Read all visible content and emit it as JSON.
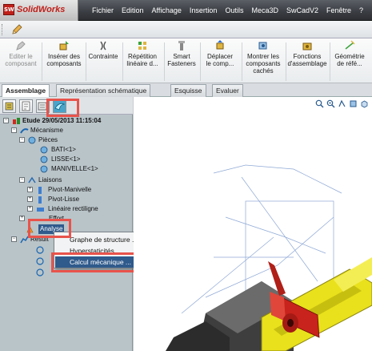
{
  "app": {
    "logo_text": "SolidWorks",
    "logo_mark": "SW"
  },
  "menu": [
    "Fichier",
    "Edition",
    "Affichage",
    "Insertion",
    "Outils",
    "Meca3D",
    "SwCadV2",
    "Fenêtre",
    "?"
  ],
  "ribbon": {
    "buttons": [
      {
        "label": "Editer le\ncomposant",
        "icon": "edit-component-icon",
        "disabled": true
      },
      {
        "label": "Insérer des\ncomposants",
        "icon": "insert-components-icon",
        "disabled": false
      },
      {
        "label": "Contrainte",
        "icon": "mate-icon",
        "disabled": false
      },
      {
        "label": "Répétition\nlinéaire d...",
        "icon": "linear-pattern-icon",
        "disabled": false
      },
      {
        "label": "Smart\nFasteners",
        "icon": "smart-fasteners-icon",
        "disabled": false
      },
      {
        "label": "Déplacer\nle comp...",
        "icon": "move-component-icon",
        "disabled": false
      },
      {
        "label": "Montrer les\ncomposants\ncachés",
        "icon": "show-hidden-icon",
        "disabled": false
      },
      {
        "label": "Fonctions\nd'assemblage",
        "icon": "assembly-features-icon",
        "disabled": false
      },
      {
        "label": "Géométrie\nde réfé...",
        "icon": "reference-geometry-icon",
        "disabled": false
      }
    ]
  },
  "tabs": [
    "Assemblage",
    "Représentation schématique",
    "Esquisse",
    "Evaluer"
  ],
  "active_tab": "Assemblage",
  "tree": {
    "study": "Etude  29/05/2013 11:15:04",
    "mechanism": "Mécanisme",
    "parts": "Pièces",
    "part_items": [
      "BATI<1>",
      "LISSE<1>",
      "MANIVELLE<1>"
    ],
    "joints": "Liaisons",
    "joint_items": [
      "Pivot-Manivelle",
      "Pivot-Lisse",
      "Linéaire rectiligne"
    ],
    "efforts": "Effort",
    "analysis": "Analyse",
    "results": "Résult"
  },
  "context_menu": {
    "items": [
      "Graphe de structure ...",
      "Hyperstaticités",
      "Calcul mécanique ..."
    ],
    "selected": "Calcul mécanique ..."
  },
  "colors": {
    "accent": "#e8534b",
    "selected": "#2f5a8c",
    "yellow_part": "#e9e11b",
    "red_part": "#c8231c"
  }
}
